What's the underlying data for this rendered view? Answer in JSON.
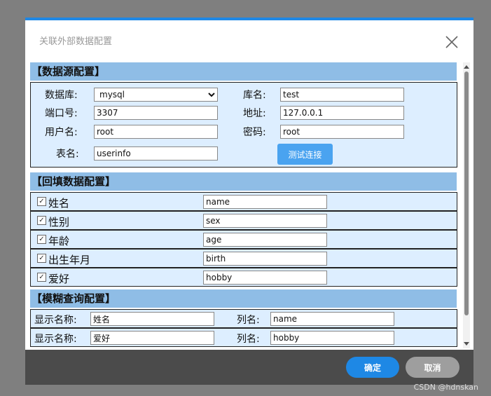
{
  "dialog": {
    "title": "关联外部数据配置"
  },
  "datasource": {
    "header": "【数据源配置】",
    "db_label": "数据库:",
    "db_value": "mysql",
    "db_options": [
      "mysql"
    ],
    "dbname_label": "库名:",
    "dbname_value": "test",
    "port_label": "端口号:",
    "port_value": "3307",
    "addr_label": "地址:",
    "addr_value": "127.0.0.1",
    "user_label": "用户名:",
    "user_value": "root",
    "pwd_label": "密码:",
    "pwd_value": "root",
    "table_label": "表名:",
    "table_value": "userinfo",
    "test_button": "测试连接"
  },
  "backfill": {
    "header": "【回填数据配置】",
    "rows": [
      {
        "label": "姓名",
        "checked": true,
        "value": "name"
      },
      {
        "label": "性别",
        "checked": true,
        "value": "sex"
      },
      {
        "label": "年龄",
        "checked": true,
        "value": "age"
      },
      {
        "label": "出生年月",
        "checked": true,
        "value": "birth"
      },
      {
        "label": "爱好",
        "checked": true,
        "value": "hobby"
      }
    ]
  },
  "fuzzy": {
    "header": "【模糊查询配置】",
    "rows": [
      {
        "display_label": "显示名称:",
        "display_value": "姓名",
        "col_label": "列名:",
        "col_value": "name"
      },
      {
        "display_label": "显示名称:",
        "display_value": "爱好",
        "col_label": "列名:",
        "col_value": "hobby"
      }
    ]
  },
  "footer": {
    "ok": "确定",
    "cancel": "取消"
  },
  "watermark": "CSDN @hdnskan",
  "colors": {
    "accent": "#1e88e5",
    "section_header": "#8fbde6",
    "row_bg": "#ddeeff",
    "footer": "#4b4b4b"
  },
  "icons": {
    "close": "close-icon",
    "check": "checkbox-check-icon"
  }
}
